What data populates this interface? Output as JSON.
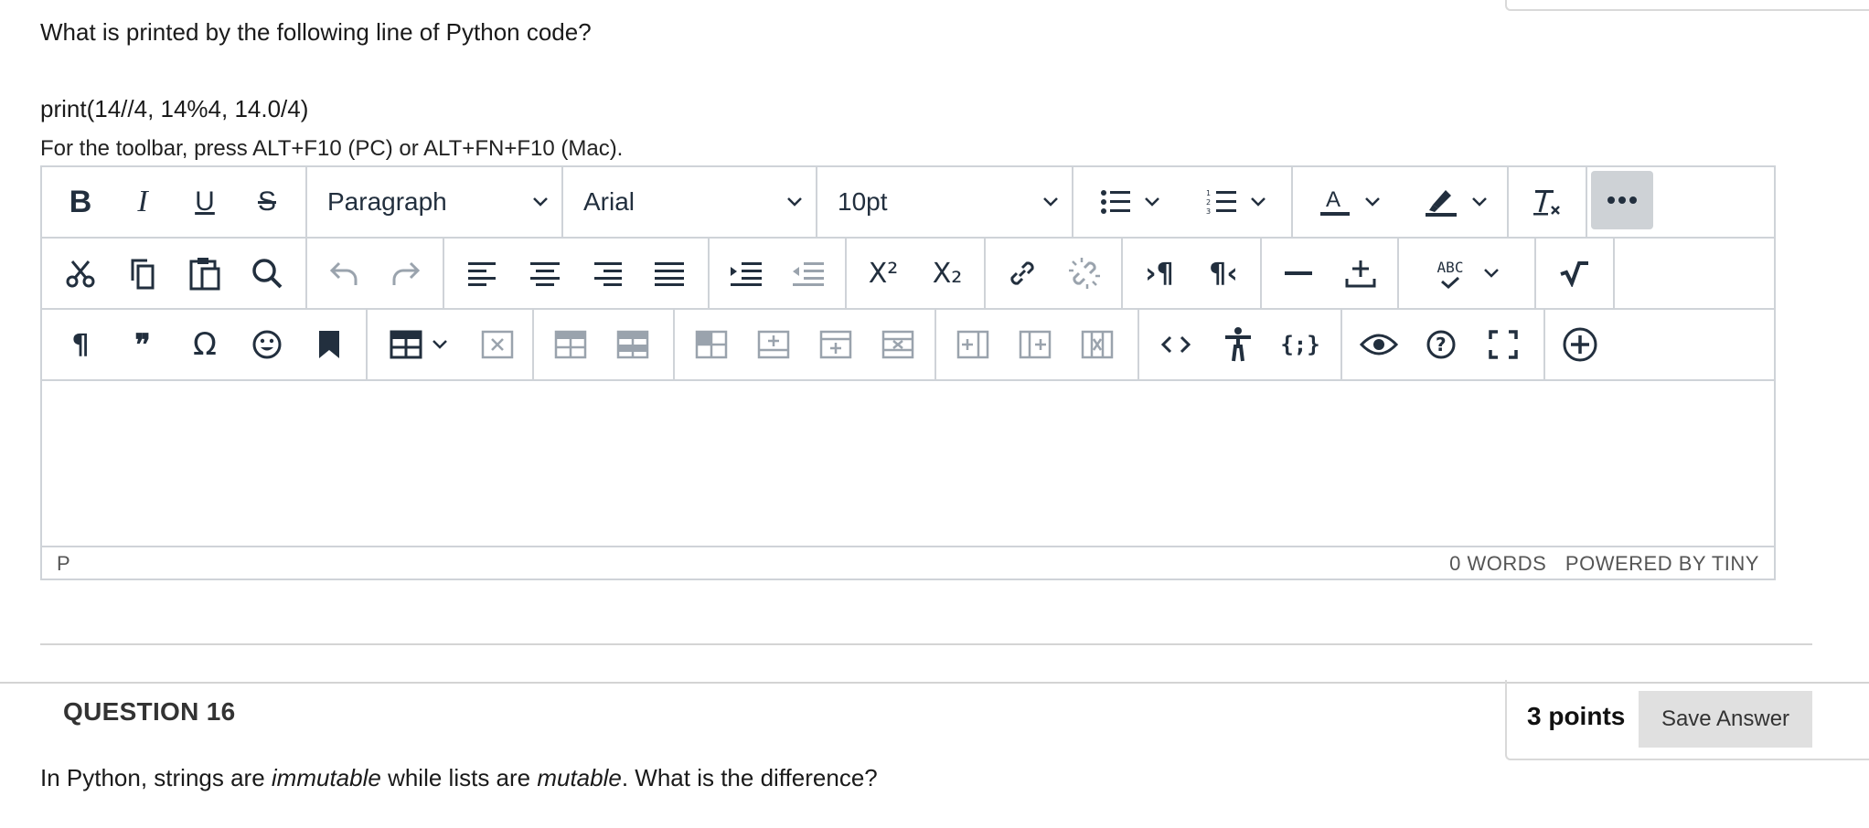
{
  "question15": {
    "prompt": "What is printed by the following line of Python code?",
    "code": "print(14//4, 14%4, 14.0/4)"
  },
  "editor": {
    "toolbar_hint": "For the toolbar, press ALT+F10 (PC) or ALT+FN+F10 (Mac).",
    "block_format": "Paragraph",
    "font_family": "Arial",
    "font_size": "10pt",
    "path": "P",
    "word_count": "0 WORDS",
    "powered_by": "POWERED BY TINY",
    "superscript_glyph": "X²",
    "subscript_glyph": "X₂",
    "spellcheck_label": "ABC",
    "codesample_label": "{;}",
    "quote_glyph": "❞",
    "omega_glyph": "Ω"
  },
  "question16": {
    "title": "QUESTION 16",
    "points": "3 points",
    "save_label": "Save Answer",
    "prompt_part1": "In Python, strings are ",
    "prompt_em1": "immutable",
    "prompt_part2": " while lists are ",
    "prompt_em2": "mutable",
    "prompt_part3": ". What is the difference?"
  },
  "colors": {
    "icon": "#222f3e",
    "icon_disabled": "#9aa3ad",
    "border": "#cfd3d8",
    "more_active_bg": "#ced2d6",
    "save_button_bg": "#e0e0e0"
  }
}
